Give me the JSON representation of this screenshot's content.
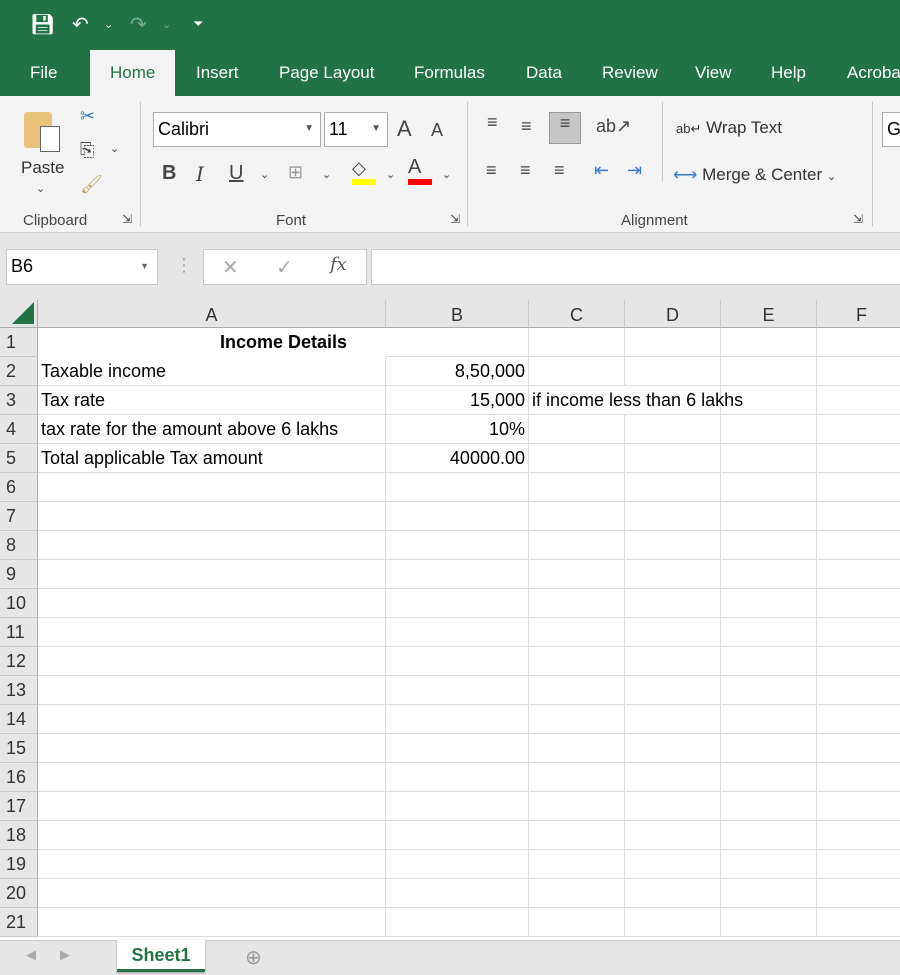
{
  "quick_access": {
    "save": "save-icon",
    "undo": "undo-icon",
    "redo": "redo-icon",
    "customize": "customize-icon"
  },
  "ribbon_tabs": [
    "File",
    "Home",
    "Insert",
    "Page Layout",
    "Formulas",
    "Data",
    "Review",
    "View",
    "Help",
    "Acroba"
  ],
  "active_tab": "Home",
  "clipboard": {
    "paste": "Paste",
    "group": "Clipboard"
  },
  "font": {
    "name": "Calibri",
    "size": "11",
    "bold": "B",
    "italic": "I",
    "underline": "U",
    "group": "Font",
    "fill_color": "#ffff00",
    "font_color": "#ff0000"
  },
  "alignment": {
    "wrap_text": "Wrap Text",
    "merge_center": "Merge & Center",
    "group": "Alignment"
  },
  "next_group_partial": "G",
  "formula_bar": {
    "name_box": "B6",
    "fx": "fx",
    "value": ""
  },
  "columns": [
    "A",
    "B",
    "C",
    "D",
    "E",
    "F"
  ],
  "rows": [
    {
      "n": "1",
      "A": "Income Details",
      "B": "",
      "C": ""
    },
    {
      "n": "2",
      "A": "Taxable income",
      "B": "8,50,000",
      "C": ""
    },
    {
      "n": "3",
      "A": "Tax rate",
      "B": "15,000",
      "C": "if income less than 6 lakhs"
    },
    {
      "n": "4",
      "A": "tax rate for the amount above 6 lakhs",
      "B": "10%",
      "C": ""
    },
    {
      "n": "5",
      "A": "Total applicable Tax amount",
      "B": "40000.00",
      "C": ""
    },
    {
      "n": "6"
    },
    {
      "n": "7"
    },
    {
      "n": "8"
    },
    {
      "n": "9"
    },
    {
      "n": "10"
    },
    {
      "n": "11"
    },
    {
      "n": "12"
    },
    {
      "n": "13"
    },
    {
      "n": "14"
    },
    {
      "n": "15"
    },
    {
      "n": "16"
    },
    {
      "n": "17"
    },
    {
      "n": "18"
    },
    {
      "n": "19"
    },
    {
      "n": "20"
    },
    {
      "n": "21"
    }
  ],
  "sheets": [
    "Sheet1"
  ],
  "accent": "#217346"
}
